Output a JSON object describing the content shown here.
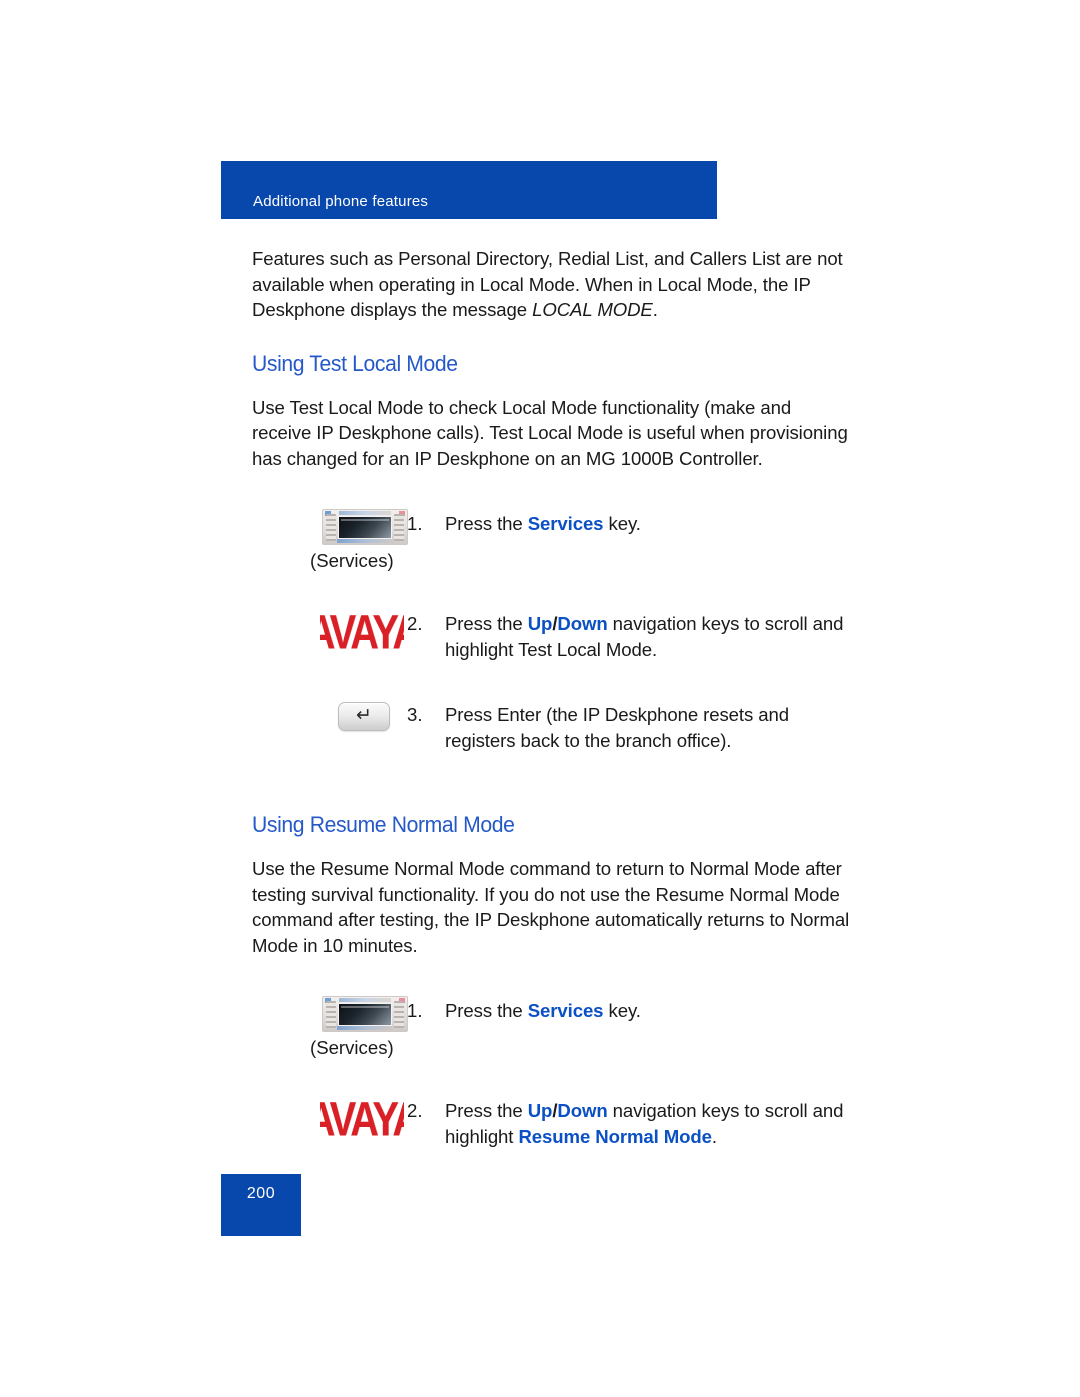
{
  "header": {
    "banner_title": "Additional phone features",
    "banner_color": "#0847ab"
  },
  "intro": {
    "text_before_italic": "Features such as Personal Directory, Redial List, and Callers List are not available when operating in Local Mode. When in Local Mode, the IP Deskphone displays the message ",
    "italic_text": "LOCAL MODE",
    "text_after_italic": "."
  },
  "sections": [
    {
      "heading": "Using Test Local Mode",
      "heading_color": "#2558c8",
      "paragraph": "Use Test Local Mode to check Local Mode functionality (make and receive IP Deskphone calls). Test Local Mode is useful when provisioning has changed for an IP Deskphone on an MG 1000B Controller.",
      "steps": [
        {
          "number": "1.",
          "icon": "services-phone-icon",
          "caption": "(Services)",
          "text_part1": "Press the ",
          "keyword1": "Services",
          "text_part2": " key.",
          "keyword2": "",
          "text_part3": ""
        },
        {
          "number": "2.",
          "icon": "avaya-logo-icon",
          "caption": "",
          "text_part1": "Press the ",
          "keyword1": "Up",
          "separator": "/",
          "keyword1b": "Down",
          "text_part2": " navigation keys to scroll and highlight Test Local Mode.",
          "keyword2": "",
          "text_part3": ""
        },
        {
          "number": "3.",
          "icon": "enter-key-icon",
          "caption": "",
          "text_part1": "Press Enter (the IP Deskphone resets and registers back to the branch office).",
          "keyword1": "",
          "text_part2": "",
          "keyword2": "",
          "text_part3": ""
        }
      ]
    },
    {
      "heading": "Using Resume Normal Mode",
      "heading_color": "#2558c8",
      "paragraph": "Use the Resume Normal Mode command to return to Normal Mode after testing survival functionality. If you do not use the Resume Normal Mode command after testing, the IP Deskphone automatically returns to Normal Mode in 10 minutes.",
      "steps": [
        {
          "number": "1.",
          "icon": "services-phone-icon",
          "caption": "(Services)",
          "text_part1": "Press the ",
          "keyword1": "Services",
          "text_part2": " key.",
          "keyword2": "",
          "text_part3": ""
        },
        {
          "number": "2.",
          "icon": "avaya-logo-icon",
          "caption": "",
          "text_part1": "Press the ",
          "keyword1": "Up",
          "separator": "/",
          "keyword1b": "Down",
          "text_part2": " navigation keys to scroll and highlight ",
          "keyword2": "Resume Normal Mode",
          "text_part3": "."
        }
      ]
    }
  ],
  "icons": {
    "avaya_wordmark": "AVAYA",
    "avaya_color": "#d92027",
    "enter_glyph": "↵"
  },
  "footer": {
    "page_number": "200",
    "block_color": "#0847ab"
  },
  "accent": {
    "keyword_blue": "#0b50c4"
  }
}
